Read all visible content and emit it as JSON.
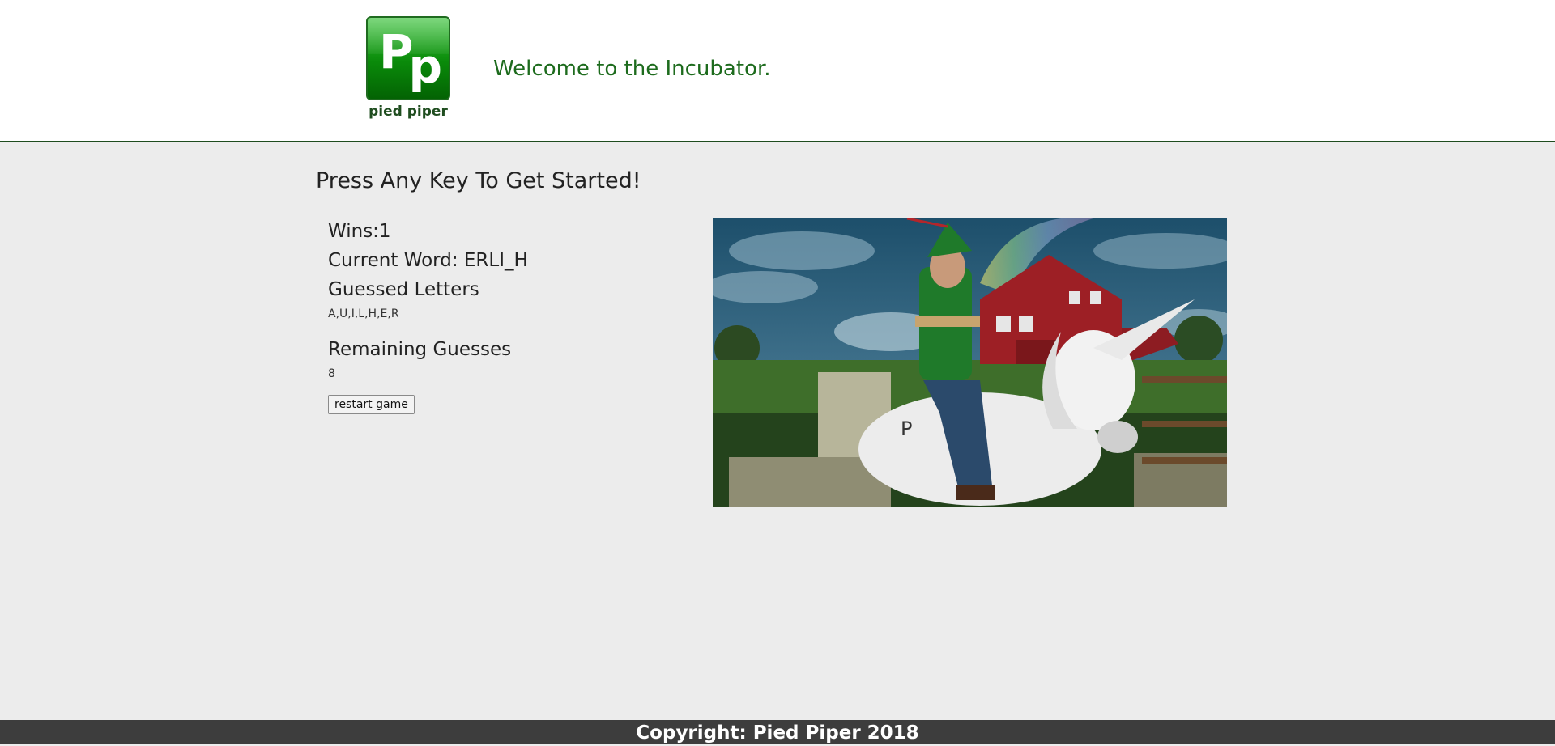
{
  "header": {
    "logo_letters": [
      "P",
      "p"
    ],
    "logo_name": "pied piper",
    "welcome": "Welcome to the Incubator."
  },
  "game": {
    "prompt": "Press Any Key To Get Started!",
    "wins_label": "Wins:1",
    "current_word_label": "Current Word: ERLI_H",
    "guessed_heading": "Guessed Letters",
    "guessed_letters": "A,U,I,L,H,E,R",
    "remaining_heading": "Remaining Guesses",
    "remaining_value": "8",
    "restart_label": "restart game"
  },
  "scene": {
    "icon": "man-riding-unicorn-photo"
  },
  "footer": {
    "copyright": "Copyright: Pied Piper 2018"
  },
  "colors": {
    "brand_green": "#1d6b1d",
    "header_border": "#1f4d1f",
    "page_bg": "#ececec",
    "footer_bg": "#3d3d3d"
  }
}
